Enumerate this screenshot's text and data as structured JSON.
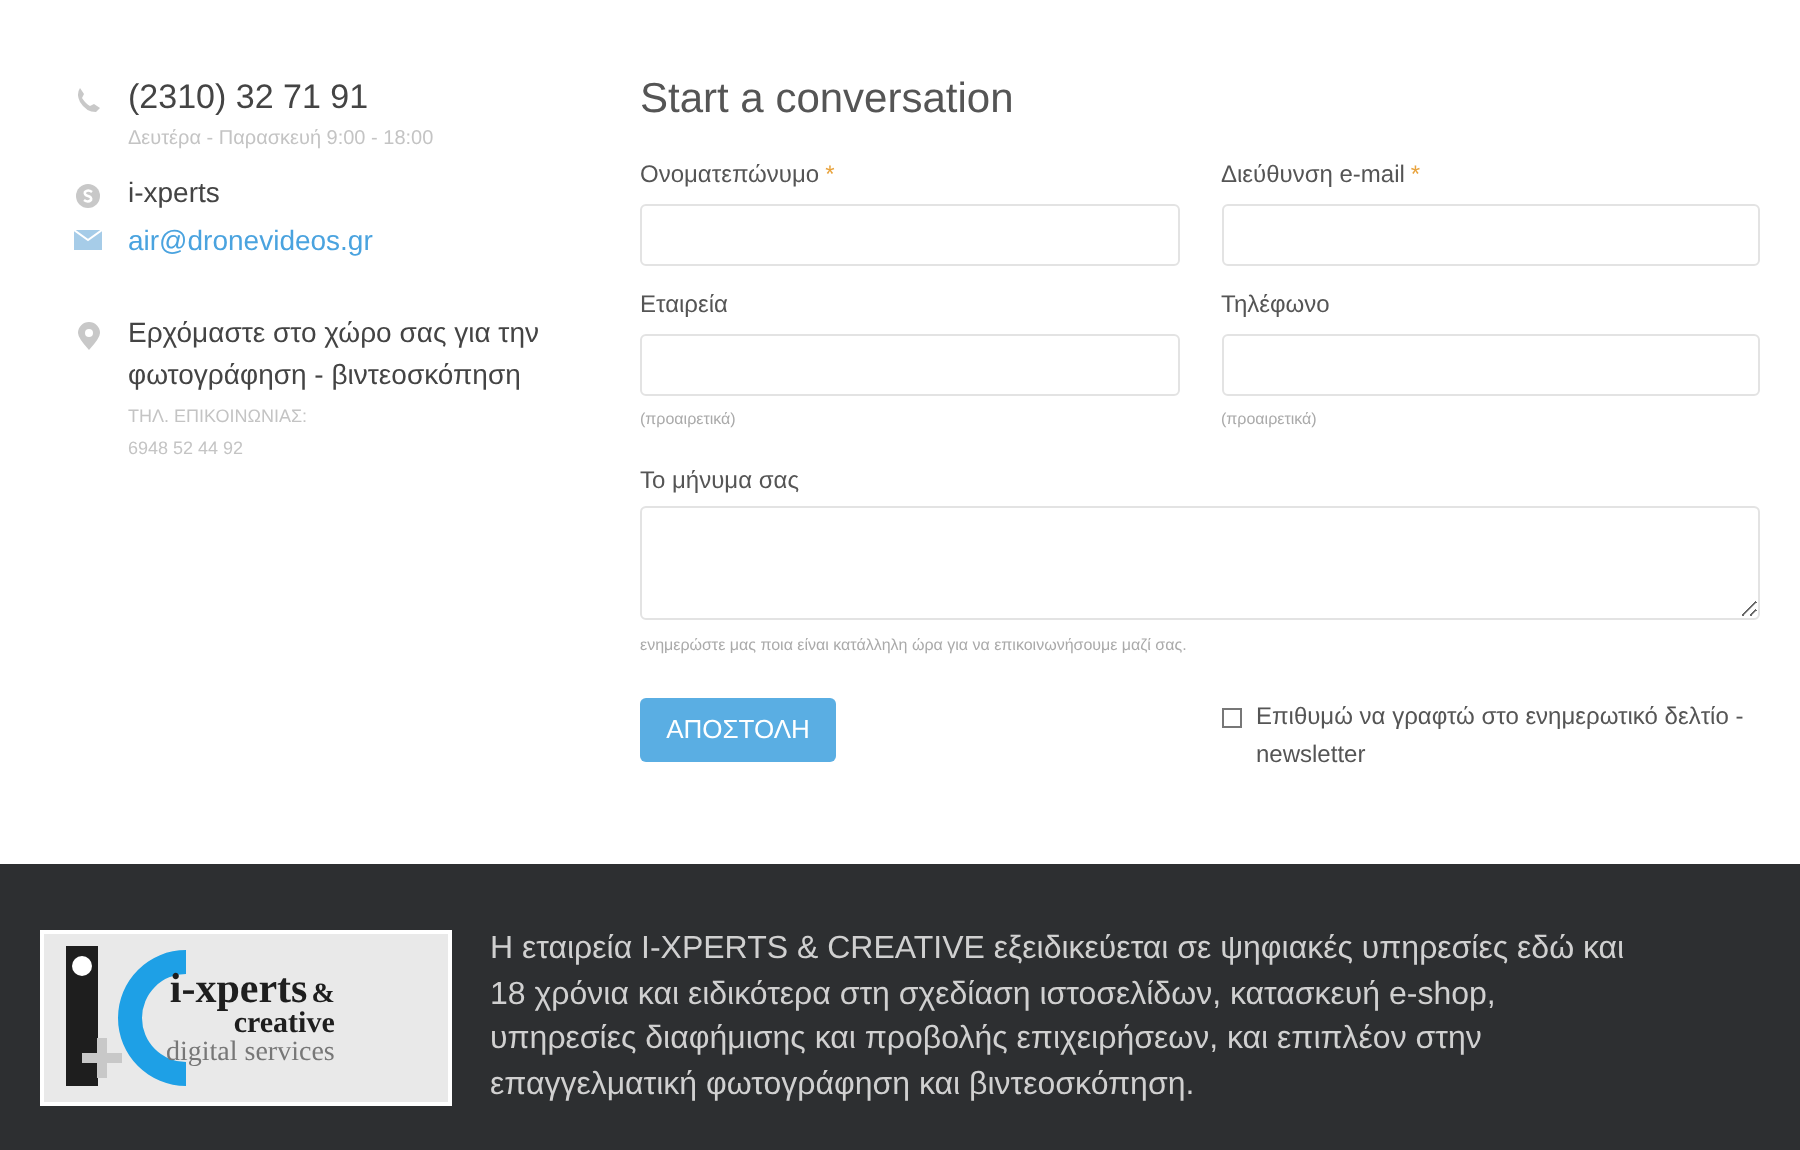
{
  "contact": {
    "phone": "(2310) 32 71 91",
    "hours": "Δευτέρα - Παρασκευή 9:00 - 18:00",
    "skype": "i-xperts",
    "email": "air@dronevideos.gr",
    "address": "Ερχόμαστε στο χώρο σας για την φωτογράφηση - βιντεοσκόπηση",
    "phone_label": "ΤΗΛ. ΕΠΙΚΟΙΝΩΝΙΑΣ:",
    "mobile": "6948 52 44 92"
  },
  "form": {
    "title": "Start a conversation",
    "fields": [
      {
        "label": "Ονοματεπώνυμο",
        "required": true
      },
      {
        "label": "Διεύθυνση e-mail",
        "required": true
      },
      {
        "label": "Εταιρεία",
        "required": false,
        "hint": "(προαιρετικά)"
      },
      {
        "label": "Τηλέφωνο",
        "required": false,
        "hint": "(προαιρετικά)"
      }
    ],
    "message": {
      "label": "Το μήνυμα σας",
      "hint": "ενημερώστε μας ποια είναι κατάλληλη ώρα για να επικοινωνήσουμε μαζί σας."
    },
    "required_mark": "*",
    "submit": "ΑΠΟΣΤΟΛΗ",
    "newsletter": {
      "label": "Επιθυμώ να γραφτώ στο ενημερωτικό δελτίο - newsletter",
      "checked": false
    }
  },
  "footer": {
    "logo": {
      "name": "i-xperts",
      "ampersand": "&",
      "line2": "creative",
      "line3": "digital services"
    },
    "text": "Η εταιρεία I-XPERTS & CREATIVE εξειδικεύεται σε ψηφιακές υπηρεσίες εδώ και 18 χρόνια και ειδικότερα στη σχεδίαση ιστοσελίδων, κατασκευή e-shop, υπηρεσίες διαφήμισης και προβολής επιχειρήσεων, και επιπλέον στην επαγγελματική φωτογράφηση και βιντεοσκόπηση."
  }
}
